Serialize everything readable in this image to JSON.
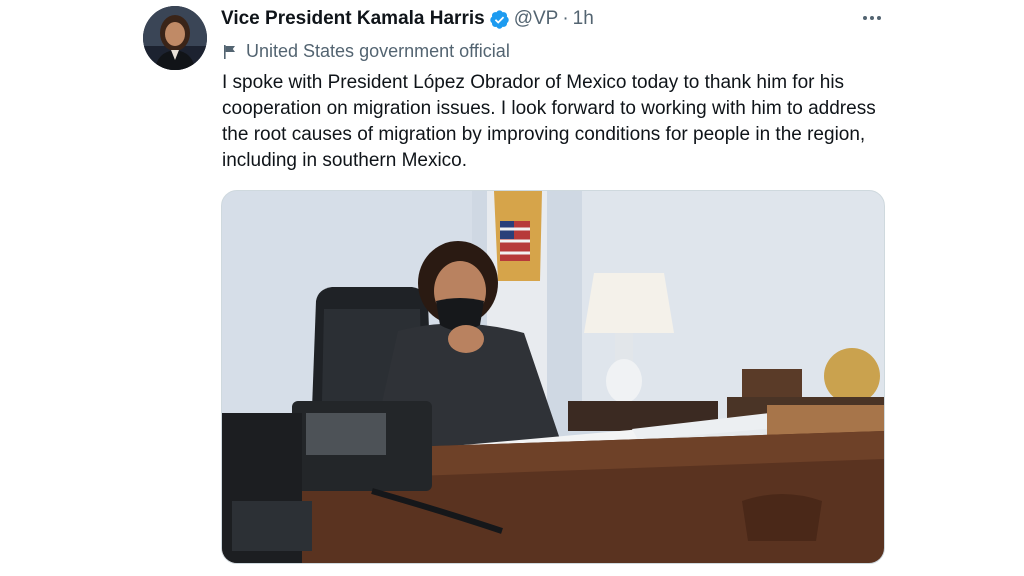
{
  "tweet": {
    "author_name": "Vice President Kamala Harris",
    "handle": "@VP",
    "separator": "·",
    "time": "1h",
    "label": "United States government official",
    "text": "I spoke with President López Obrador of Mexico today to thank him for his cooperation on migration issues. I look forward to working with him to address the root causes of migration by improving conditions for people in the region, including in southern Mexico."
  },
  "icons": {
    "verified": "verified-badge-icon",
    "more": "more-options-icon",
    "gov_label": "flag-icon"
  },
  "colors": {
    "verified": "#1d9bf0",
    "secondary_text": "#536471",
    "primary_text": "#0f1419"
  }
}
